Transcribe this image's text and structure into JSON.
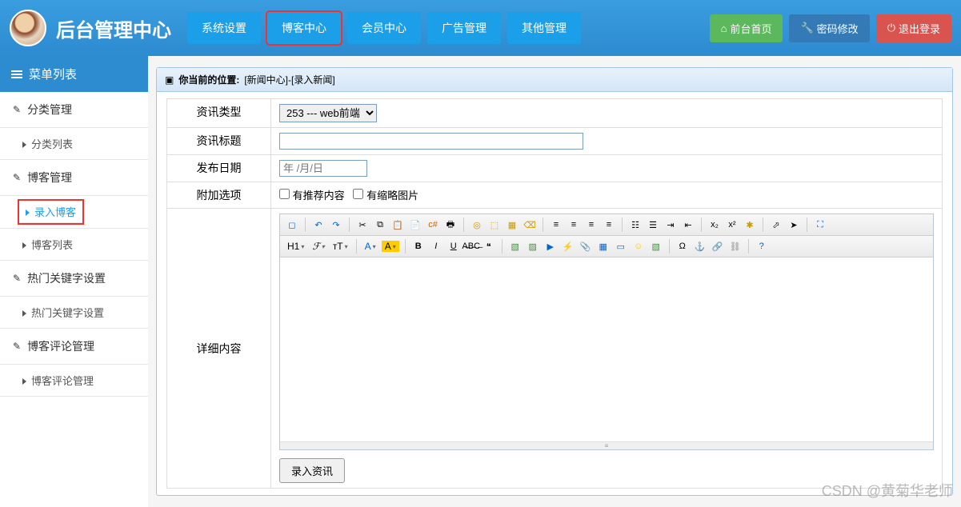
{
  "header": {
    "title": "后台管理中心",
    "nav": [
      "系统设置",
      "博客中心",
      "会员中心",
      "广告管理",
      "其他管理"
    ],
    "nav_highlight_index": 1,
    "right": {
      "front": "前台首页",
      "pwd": "密码修改",
      "logout": "退出登录"
    }
  },
  "sidebar": {
    "head": "菜单列表",
    "sections": [
      {
        "label": "分类管理",
        "items": [
          "分类列表"
        ]
      },
      {
        "label": "博客管理",
        "items": [
          "录入博客",
          "博客列表"
        ],
        "active_index": 0,
        "highlight_index": 0
      },
      {
        "label": "热门关键字设置",
        "items": [
          "热门关键字设置"
        ]
      },
      {
        "label": "博客评论管理",
        "items": [
          "博客评论管理"
        ]
      }
    ]
  },
  "panel": {
    "breadcrumb_label": "你当前的位置:",
    "breadcrumb_path": "[新闻中心]-[录入新闻]"
  },
  "form": {
    "type_label": "资讯类型",
    "type_value": "253 --- web前端",
    "title_label": "资讯标题",
    "title_value": "",
    "date_label": "发布日期",
    "date_placeholder": "年 /月/日",
    "extra_label": "附加选项",
    "cb_recommend": "有推荐内容",
    "cb_thumb": "有缩略图片",
    "detail_label": "详细内容",
    "submit": "录入资讯"
  },
  "editor": {
    "row1": [
      "source",
      "undo",
      "redo",
      "|",
      "cut",
      "copy",
      "paste",
      "paste-text",
      "paste-word",
      "|",
      "print",
      "preview",
      "template",
      "code",
      "c#",
      "cut2",
      "|",
      "find",
      "replace",
      "select-all",
      "remove-format",
      "|",
      "align-left",
      "align-center",
      "align-right",
      "align-justify",
      "|",
      "list-ol",
      "list-ul",
      "indent",
      "outdent",
      "|",
      "sub",
      "sup",
      "clear",
      "|",
      "dir",
      "select",
      "fullscreen"
    ],
    "row2_labels": {
      "h1": "H1",
      "font": "ℱ",
      "size": "тT",
      "color": "A",
      "bg": "A"
    },
    "row2": [
      "bold",
      "italic",
      "underline",
      "strike",
      "abc",
      "|",
      "image",
      "multi-image",
      "media",
      "flash",
      "file",
      "attach",
      "table",
      "hr",
      "emoji",
      "map",
      "|",
      "symbol",
      "anchor",
      "link",
      "unlink",
      "|",
      "help"
    ]
  },
  "watermark": "CSDN @黄菊华老师"
}
